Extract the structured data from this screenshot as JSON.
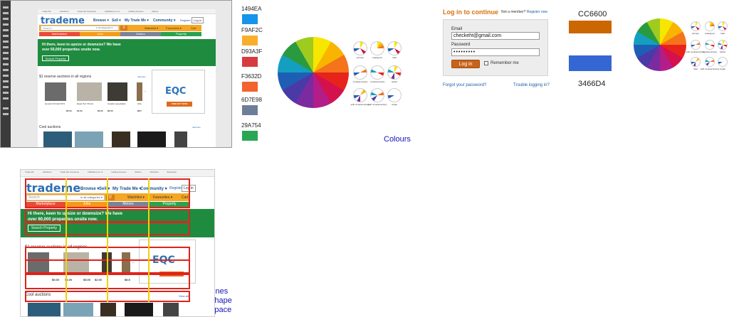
{
  "tm": {
    "tabs": [
      "Trade Me",
      "LifeDirect",
      "Trade Me Insurance",
      "FlatMates.co.nz",
      "Holiday Houses",
      "Motors",
      "Watchlist",
      "Bookshop"
    ],
    "logo": "trademe",
    "nav": [
      "Browse ▾",
      "Sell ▾",
      "My Trade Me ▾",
      "Community ▾"
    ],
    "register": "Register",
    "login": "Log in",
    "search_placeholder": "Search",
    "categories": "in all categories ▾",
    "watchlist": "Watchlist ▾",
    "favourites": "Favourites ▾",
    "cart": "Cart",
    "catbar": [
      "Marketplace",
      "Jobs",
      "Motors",
      "Property"
    ],
    "hero_line1": "Hi there, keen to upsize or downsize? We have",
    "hero_line2": "over 60,000 properties onsite now.",
    "hero_button": "Search Property",
    "reserve_heading": "$1 reserve auctions in all regions",
    "view_all": "View all ›",
    "ad_brand": "EQC",
    "ad_button": "FIND OUT NOW",
    "items": [
      {
        "title": "Hervell 10 Frath 8/74",
        "price": "$0.00"
      },
      {
        "title": "Daed Tsci 70mml",
        "price": "$1.00"
      },
      {
        "title": "Candle Lamp/lights",
        "price": "$2.00"
      },
      {
        "title": "Gifa",
        "price": "$8.5"
      }
    ],
    "cool_heading": "Cool auctions",
    "price_row": [
      "$0.00",
      "$1.00",
      "$5.00",
      "$2.00",
      "$8.5"
    ]
  },
  "swatches": [
    {
      "code": "1494EA",
      "color": "#1494EA"
    },
    {
      "code": "F9AF2C",
      "color": "#F9AF2C"
    },
    {
      "code": "D93A3F",
      "color": "#D93A3F"
    },
    {
      "code": "F3632D",
      "color": "#F3632D"
    },
    {
      "code": "6D7E98",
      "color": "#6D7E98"
    },
    {
      "code": "29A754",
      "color": "#29A754"
    }
  ],
  "wheel_labels": [
    "primary",
    "analogous",
    "triad",
    "complementary",
    "complementary",
    "tetrad",
    "split complementary",
    "split complementary",
    "single"
  ],
  "wheel_labels_right": [
    "primary",
    "analogous",
    "triad",
    "split complementary",
    "complementary",
    "tetrad",
    "triad",
    "split complementary",
    "single"
  ],
  "login": {
    "title": "Log in to continue",
    "not_member": "Not a member?",
    "register_now": "Register now",
    "email_label": "Email",
    "email_value": "checkeht@gmail.com",
    "password_label": "Password",
    "password_value": "•••••••••",
    "button": "Log in",
    "remember": "Remember me",
    "forgot": "Forgot your password?",
    "trouble": "Trouble logging in?"
  },
  "big_swatches": [
    {
      "code": "CC6600",
      "color": "#CC6600"
    },
    {
      "code": "3466D4",
      "color": "#3466D4"
    }
  ],
  "captions": {
    "colours": "Colours",
    "lines": "Lines",
    "shape": "Shape",
    "space": "Space"
  }
}
